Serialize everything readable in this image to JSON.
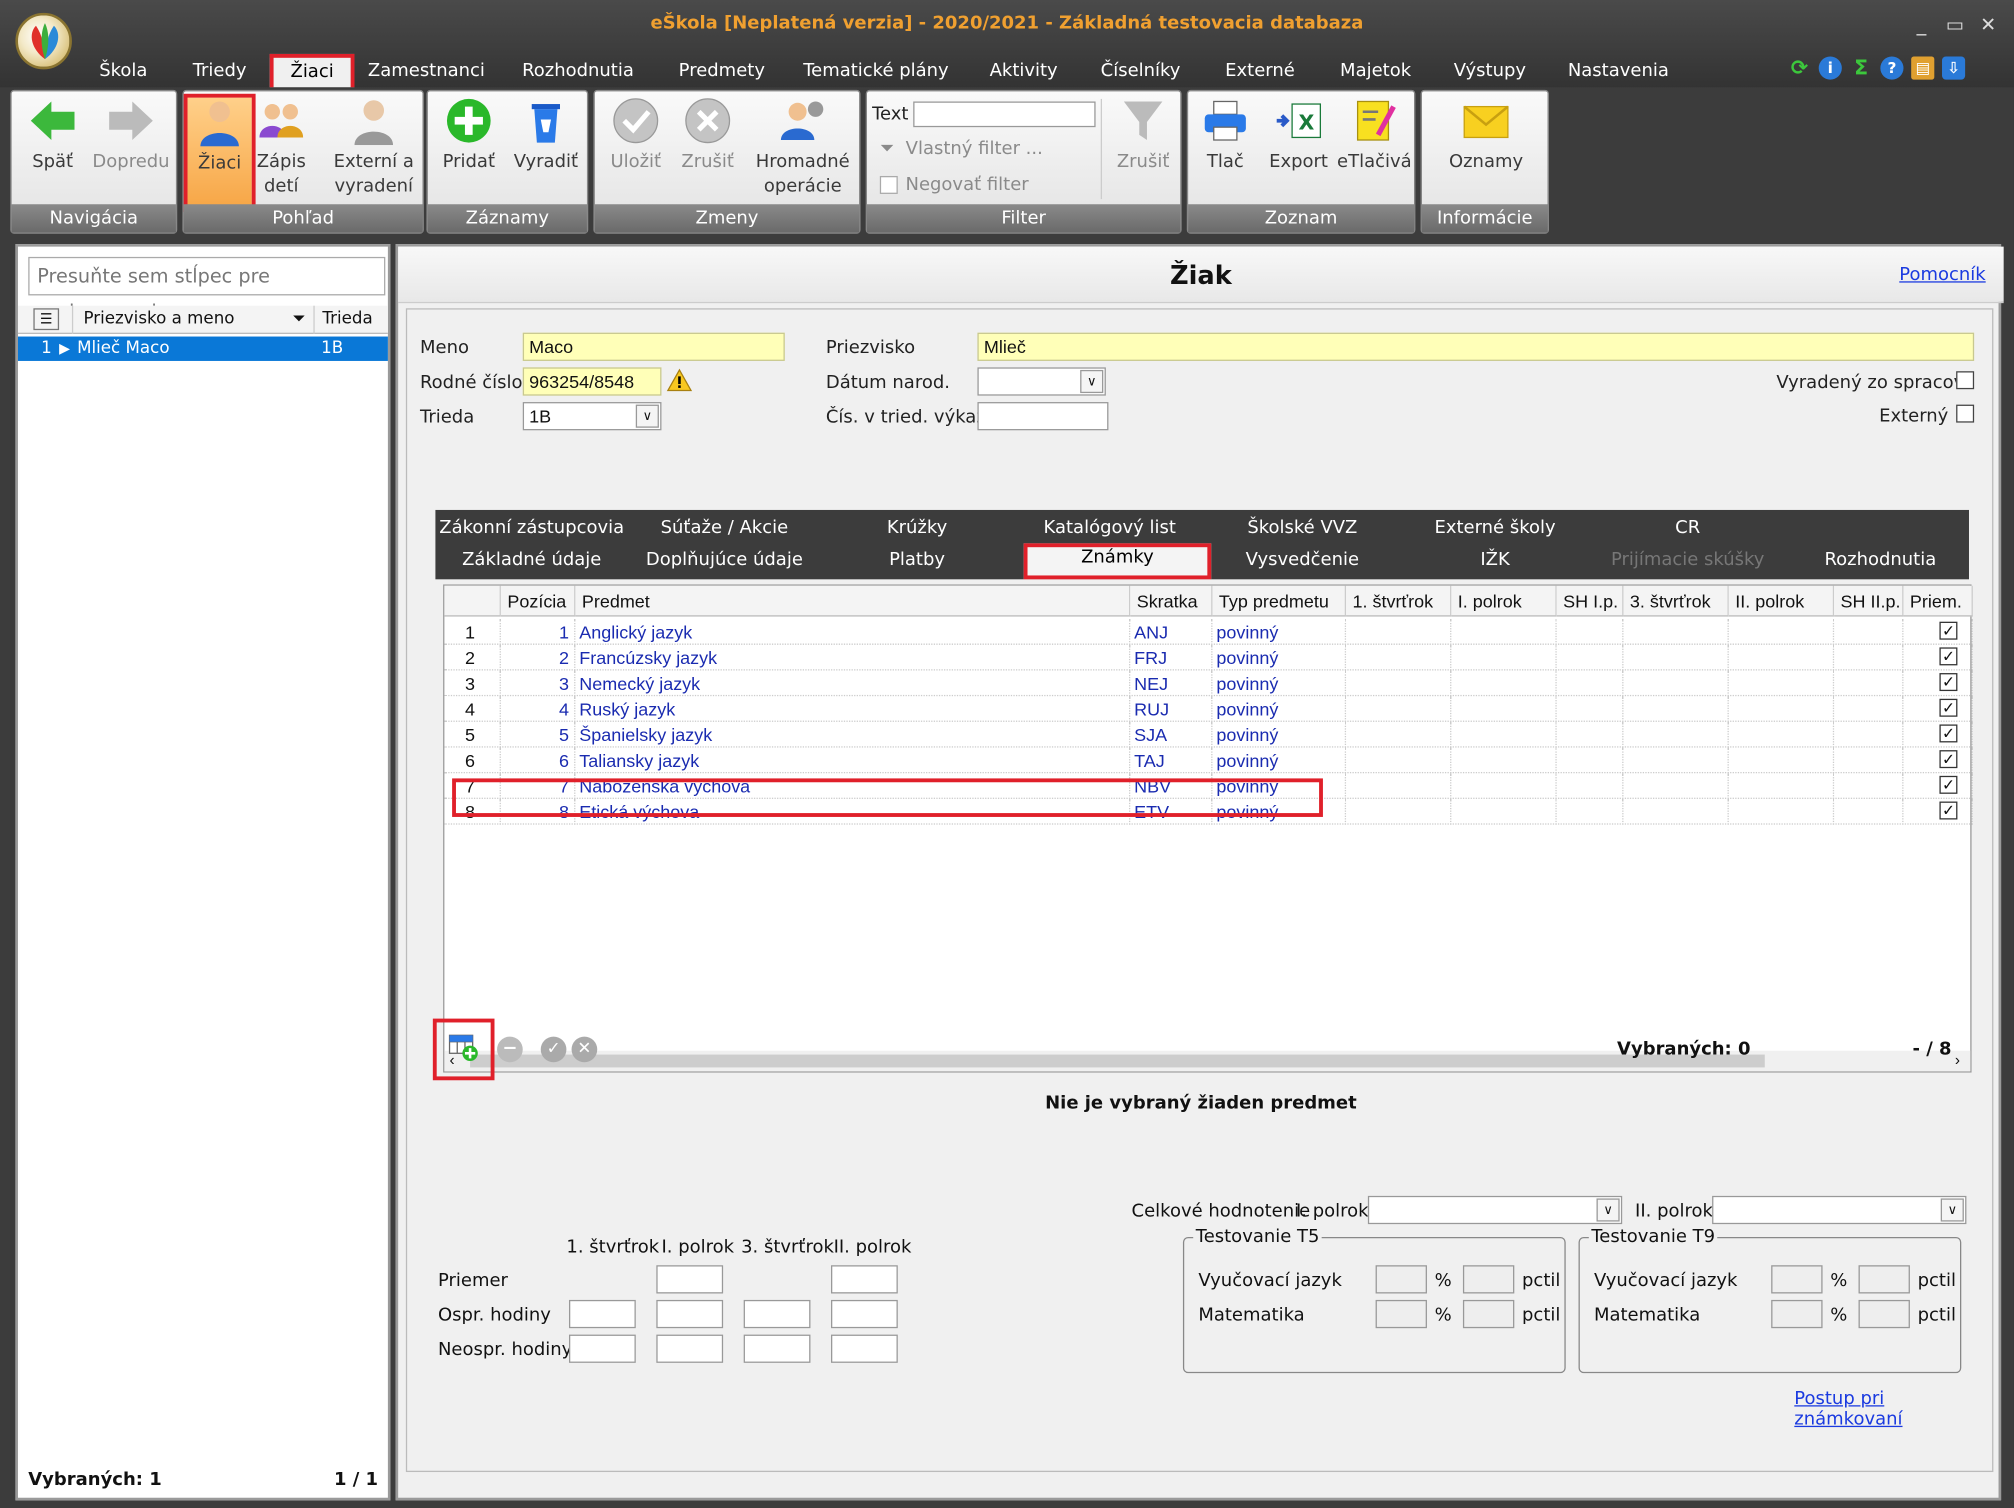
{
  "title": "eŠkola [Neplatená verzia] - 2020/2021 - Základná testovacia databaza",
  "menu": [
    "Škola",
    "Triedy",
    "Žiaci",
    "Zamestnanci",
    "Rozhodnutia",
    "Predmety",
    "Tematické plány",
    "Aktivity",
    "Číselníky",
    "Externé",
    "Majetok",
    "Výstupy",
    "Nastavenia"
  ],
  "ribbon": {
    "nav": {
      "label": "Navigácia",
      "back": "Späť",
      "forward": "Dopredu"
    },
    "view": {
      "label": "Pohľad",
      "students": "Žiaci",
      "enroll_1": "Zápis",
      "enroll_2": "detí",
      "external_1": "Externí a",
      "external_2": "vyradení"
    },
    "records": {
      "label": "Záznamy",
      "add": "Pridať",
      "remove": "Vyradiť"
    },
    "changes": {
      "label": "Zmeny",
      "save": "Uložiť",
      "cancel": "Zrušiť",
      "bulk_1": "Hromadné",
      "bulk_2": "operácie"
    },
    "filter": {
      "label": "Filter",
      "text": "Text",
      "custom": "Vlastný filter ...",
      "negate": "Negovať filter",
      "cancel": "Zrušiť"
    },
    "list": {
      "label": "Zoznam",
      "print": "Tlač",
      "export": "Export",
      "eprint": "eTlačivá"
    },
    "info": {
      "label": "Informácie",
      "notices": "Oznamy"
    }
  },
  "left": {
    "group_hint": "Presuňte sem stĺpec pre zoskupovanie",
    "col_name": "Priezvisko a meno",
    "col_class": "Trieda",
    "row_num": "1",
    "row_name": "Mlieč Maco",
    "row_class": "1B",
    "selected": "Vybraných: 1",
    "pager": "1 / 1"
  },
  "main": {
    "title": "Žiak",
    "help": "Pomocník",
    "labels": {
      "name": "Meno",
      "surname": "Priezvisko",
      "birth_no": "Rodné číslo",
      "birth_date": "Dátum narod.",
      "class": "Trieda",
      "class_no": "Čís. v tried. výkaze",
      "excluded": "Vyradený zo spracov.",
      "external": "Externý"
    },
    "values": {
      "name": "Maco",
      "surname": "Mlieč",
      "birth_no": "963254/8548",
      "class": "1B"
    },
    "tabs_top": [
      "Zákonní zástupcovia",
      "Súťaže / Akcie",
      "Krúžky",
      "Katalógový list",
      "Školské VVZ",
      "Externé školy",
      "CR"
    ],
    "tabs_bottom": [
      "Základné údaje",
      "Doplňujúce údaje",
      "Platby",
      "Známky",
      "Vysvedčenie",
      "IŽK",
      "Prijímacie skúšky",
      "Rozhodnutia"
    ],
    "grid_headers": [
      "Pozícia",
      "Predmet",
      "Skratka",
      "Typ predmetu",
      "1. štvrťrok",
      "I. polrok",
      "SH I.p.",
      "3. štvrťrok",
      "II. polrok",
      "SH II.p.",
      "Priem."
    ],
    "rows": [
      {
        "n": "1",
        "pos": "1",
        "subject": "Anglický jazyk",
        "abbr": "ANJ",
        "type": "povinný"
      },
      {
        "n": "2",
        "pos": "2",
        "subject": "Francúzsky jazyk",
        "abbr": "FRJ",
        "type": "povinný"
      },
      {
        "n": "3",
        "pos": "3",
        "subject": "Nemecký jazyk",
        "abbr": "NEJ",
        "type": "povinný"
      },
      {
        "n": "4",
        "pos": "4",
        "subject": "Ruský jazyk",
        "abbr": "RUJ",
        "type": "povinný"
      },
      {
        "n": "5",
        "pos": "5",
        "subject": "Španielsky jazyk",
        "abbr": "SJA",
        "type": "povinný"
      },
      {
        "n": "6",
        "pos": "6",
        "subject": "Taliansky jazyk",
        "abbr": "TAJ",
        "type": "povinný"
      },
      {
        "n": "7",
        "pos": "7",
        "subject": "Náboženská výchova",
        "abbr": "NBV",
        "type": "povinný"
      },
      {
        "n": "8",
        "pos": "8",
        "subject": "Etická výchova",
        "abbr": "ETV",
        "type": "povinný"
      }
    ],
    "selected": "Vybraných: 0",
    "count": "- / 8",
    "no_subject": "Nie je vybraný žiaden predmet",
    "overall": "Celkové hodnotenie",
    "half1": "I. polrok",
    "half2": "II. polrok",
    "stats_cols": [
      "1. štvrťrok",
      "I. polrok",
      "3. štvrťrok",
      "II. polrok"
    ],
    "stats_rows": [
      "Priemer",
      "Ospr. hodiny",
      "Neospr. hodiny"
    ],
    "t5": "Testovanie T5",
    "t9": "Testovanie T9",
    "lang": "Vyučovací jazyk",
    "math": "Matematika",
    "pct": "%",
    "pctil": "pctil",
    "grading_link": "Postup pri známkovaní"
  }
}
